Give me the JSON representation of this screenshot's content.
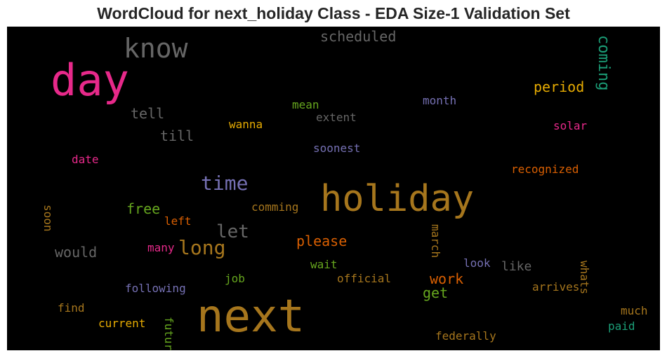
{
  "chart_data": {
    "type": "wordcloud",
    "title": "WordCloud for next_holiday Class - EDA Size-1 Validation Set",
    "words": [
      {
        "text": "holiday",
        "color": "#a6761d"
      },
      {
        "text": "next",
        "color": "#a6761d"
      },
      {
        "text": "day",
        "color": "#e7298a"
      },
      {
        "text": "know",
        "color": "#666666"
      },
      {
        "text": "time",
        "color": "#7570b3"
      },
      {
        "text": "long",
        "color": "#a6761d"
      },
      {
        "text": "coming",
        "color": "#1b9e77"
      },
      {
        "text": "let",
        "color": "#666666"
      },
      {
        "text": "scheduled",
        "color": "#666666"
      },
      {
        "text": "period",
        "color": "#e6ab02"
      },
      {
        "text": "tell",
        "color": "#666666"
      },
      {
        "text": "till",
        "color": "#666666"
      },
      {
        "text": "please",
        "color": "#d95f02"
      },
      {
        "text": "free",
        "color": "#66a61e"
      },
      {
        "text": "would",
        "color": "#666666"
      },
      {
        "text": "work",
        "color": "#d95f02"
      },
      {
        "text": "get",
        "color": "#66a61e"
      },
      {
        "text": "like",
        "color": "#666666"
      },
      {
        "text": "mean",
        "color": "#66a61e"
      },
      {
        "text": "month",
        "color": "#7570b3"
      },
      {
        "text": "extent",
        "color": "#666666"
      },
      {
        "text": "wanna",
        "color": "#e6ab02"
      },
      {
        "text": "solar",
        "color": "#e7298a"
      },
      {
        "text": "soonest",
        "color": "#7570b3"
      },
      {
        "text": "date",
        "color": "#e7298a"
      },
      {
        "text": "recognized",
        "color": "#d95f02"
      },
      {
        "text": "comming",
        "color": "#a6761d"
      },
      {
        "text": "soon",
        "color": "#a6761d"
      },
      {
        "text": "left",
        "color": "#d95f02"
      },
      {
        "text": "many",
        "color": "#e7298a"
      },
      {
        "text": "march",
        "color": "#a6761d"
      },
      {
        "text": "wait",
        "color": "#66a61e"
      },
      {
        "text": "look",
        "color": "#7570b3"
      },
      {
        "text": "whats",
        "color": "#a6761d"
      },
      {
        "text": "job",
        "color": "#66a61e"
      },
      {
        "text": "official",
        "color": "#a6761d"
      },
      {
        "text": "following",
        "color": "#7570b3"
      },
      {
        "text": "arrives",
        "color": "#a6761d"
      },
      {
        "text": "find",
        "color": "#a6761d"
      },
      {
        "text": "much",
        "color": "#a6761d"
      },
      {
        "text": "current",
        "color": "#e6ab02"
      },
      {
        "text": "future",
        "color": "#66a61e"
      },
      {
        "text": "paid",
        "color": "#1b9e77"
      },
      {
        "text": "federally",
        "color": "#a6761d"
      }
    ]
  }
}
